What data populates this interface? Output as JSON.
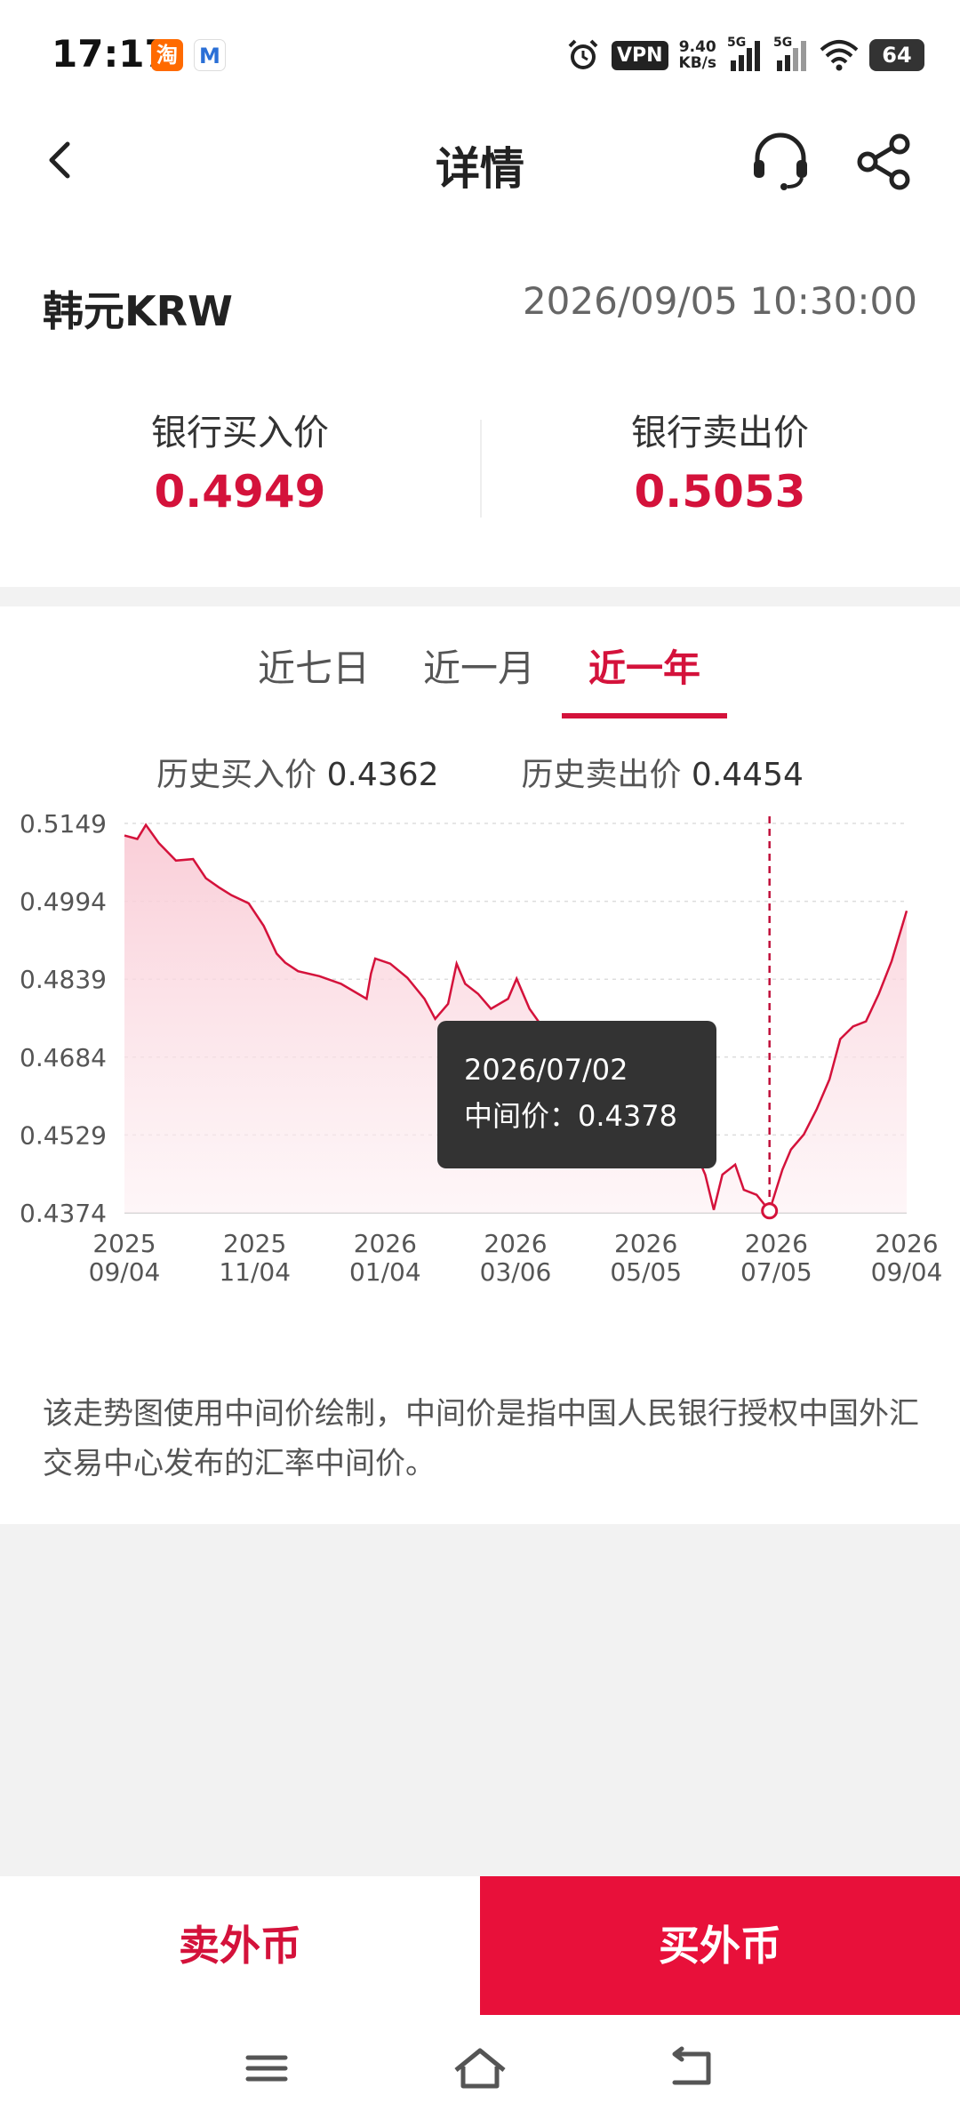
{
  "status_bar": {
    "time": "17:17",
    "app_icons": [
      {
        "name": "taobao-icon",
        "glyph": "淘"
      },
      {
        "name": "mail-icon",
        "glyph": "M"
      }
    ],
    "vpn": "VPN",
    "speed_value": "9.40",
    "speed_unit": "KB/s",
    "signal1": "5G",
    "signal2": "5G",
    "battery": "64"
  },
  "header": {
    "title": "详情",
    "icons": [
      "back-arrow-icon",
      "headset-icon",
      "share-icon"
    ]
  },
  "currency": {
    "name": "韩元KRW",
    "datetime": "2026/09/05 10:30:00",
    "buy_label": "银行买入价",
    "buy_value": "0.4949",
    "sell_label": "银行卖出价",
    "sell_value": "0.5053"
  },
  "tabs": [
    {
      "label": "近七日",
      "active": false
    },
    {
      "label": "近一月",
      "active": false
    },
    {
      "label": "近一年",
      "active": true
    }
  ],
  "history": {
    "buy_label": "历史买入价",
    "buy_value": "0.4362",
    "sell_label": "历史卖出价",
    "sell_value": "0.4454"
  },
  "chart_data": {
    "type": "area",
    "y_ticks": [
      "0.5149",
      "0.4994",
      "0.4839",
      "0.4684",
      "0.4529",
      "0.4374"
    ],
    "ylim": [
      0.4374,
      0.5149
    ],
    "x_ticks": [
      {
        "year": "2025",
        "date": "09/04"
      },
      {
        "year": "2025",
        "date": "11/04"
      },
      {
        "year": "2026",
        "date": "01/04"
      },
      {
        "year": "2026",
        "date": "03/06"
      },
      {
        "year": "2026",
        "date": "05/05"
      },
      {
        "year": "2026",
        "date": "07/05"
      },
      {
        "year": "2026",
        "date": "09/04"
      }
    ],
    "grid": "horizontal dashed",
    "line_color": "#d4123b",
    "fill_color": "#fde3e9",
    "points": [
      [
        "2025-09-04",
        0.5125
      ],
      [
        "2025-09-10",
        0.5118
      ],
      [
        "2025-09-14",
        0.5146
      ],
      [
        "2025-09-20",
        0.511
      ],
      [
        "2025-09-28",
        0.5075
      ],
      [
        "2025-10-06",
        0.5078
      ],
      [
        "2025-10-12",
        0.504
      ],
      [
        "2025-10-18",
        0.5022
      ],
      [
        "2025-10-24",
        0.5006
      ],
      [
        "2025-11-01",
        0.499
      ],
      [
        "2025-11-08",
        0.4945
      ],
      [
        "2025-11-14",
        0.489
      ],
      [
        "2025-11-18",
        0.4872
      ],
      [
        "2025-11-24",
        0.4855
      ],
      [
        "2025-12-04",
        0.4845
      ],
      [
        "2025-12-14",
        0.483
      ],
      [
        "2025-12-26",
        0.48
      ],
      [
        "2025-12-28",
        0.485
      ],
      [
        "2025-12-30",
        0.488
      ],
      [
        "2026-01-06",
        0.487
      ],
      [
        "2026-01-14",
        0.4842
      ],
      [
        "2026-01-22",
        0.48
      ],
      [
        "2026-01-27",
        0.476
      ],
      [
        "2026-02-02",
        0.479
      ],
      [
        "2026-02-06",
        0.487
      ],
      [
        "2026-02-10",
        0.483
      ],
      [
        "2026-02-16",
        0.481
      ],
      [
        "2026-02-22",
        0.478
      ],
      [
        "2026-03-02",
        0.48
      ],
      [
        "2026-03-06",
        0.484
      ],
      [
        "2026-03-12",
        0.478
      ],
      [
        "2026-03-22",
        0.472
      ],
      [
        "2026-04-06",
        0.469
      ],
      [
        "2026-04-20",
        0.465
      ],
      [
        "2026-05-02",
        0.46
      ],
      [
        "2026-05-12",
        0.455
      ],
      [
        "2026-05-20",
        0.449
      ],
      [
        "2026-05-26",
        0.452
      ],
      [
        "2026-06-02",
        0.445
      ],
      [
        "2026-06-06",
        0.438
      ],
      [
        "2026-06-10",
        0.445
      ],
      [
        "2026-06-16",
        0.447
      ],
      [
        "2026-06-20",
        0.442
      ],
      [
        "2026-06-26",
        0.441
      ],
      [
        "2026-07-02",
        0.4378
      ],
      [
        "2026-07-08",
        0.446
      ],
      [
        "2026-07-12",
        0.45
      ],
      [
        "2026-07-18",
        0.453
      ],
      [
        "2026-07-24",
        0.458
      ],
      [
        "2026-07-30",
        0.464
      ],
      [
        "2026-08-04",
        0.472
      ],
      [
        "2026-08-10",
        0.4745
      ],
      [
        "2026-08-16",
        0.4755
      ],
      [
        "2026-08-22",
        0.481
      ],
      [
        "2026-08-28",
        0.4875
      ],
      [
        "2026-09-04",
        0.4975
      ]
    ],
    "tooltip": {
      "date": "2026/07/02",
      "label": "中间价：",
      "value": "0.4378",
      "x": "2026-07-02",
      "y": 0.4378
    }
  },
  "note": "该走势图使用中间价绘制，中间价是指中国人民银行授权中国外汇交易中心发布的汇率中间价。",
  "actions": {
    "sell_label": "卖外币",
    "buy_label": "买外币"
  },
  "nav": [
    "menu-icon",
    "home-icon",
    "back-icon"
  ]
}
